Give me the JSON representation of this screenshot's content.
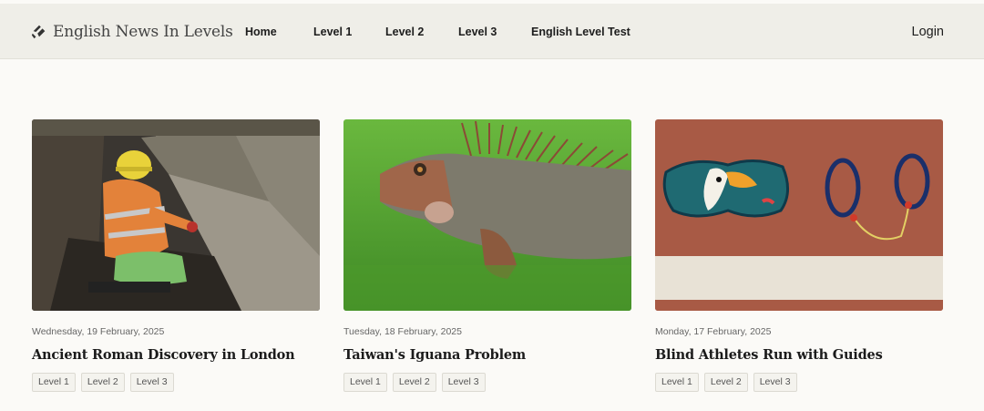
{
  "header": {
    "brand": "English News In Levels",
    "nav": [
      "Home",
      "Level 1",
      "Level 2",
      "Level 3",
      "English Level Test"
    ],
    "login": "Login"
  },
  "articles": [
    {
      "date": "Wednesday, 19 February, 2025",
      "title": "Ancient Roman Discovery in London",
      "levels": [
        "Level 1",
        "Level 2",
        "Level 3"
      ],
      "image": "archaeologist-excavation-photo"
    },
    {
      "date": "Tuesday, 18 February, 2025",
      "title": "Taiwan's Iguana Problem",
      "levels": [
        "Level 1",
        "Level 2",
        "Level 3"
      ],
      "image": "iguana-on-grass-photo"
    },
    {
      "date": "Monday, 17 February, 2025",
      "title": "Blind Athletes Run with Guides",
      "levels": [
        "Level 1",
        "Level 2",
        "Level 3"
      ],
      "image": "eye-mask-and-tether-on-track-photo"
    }
  ]
}
